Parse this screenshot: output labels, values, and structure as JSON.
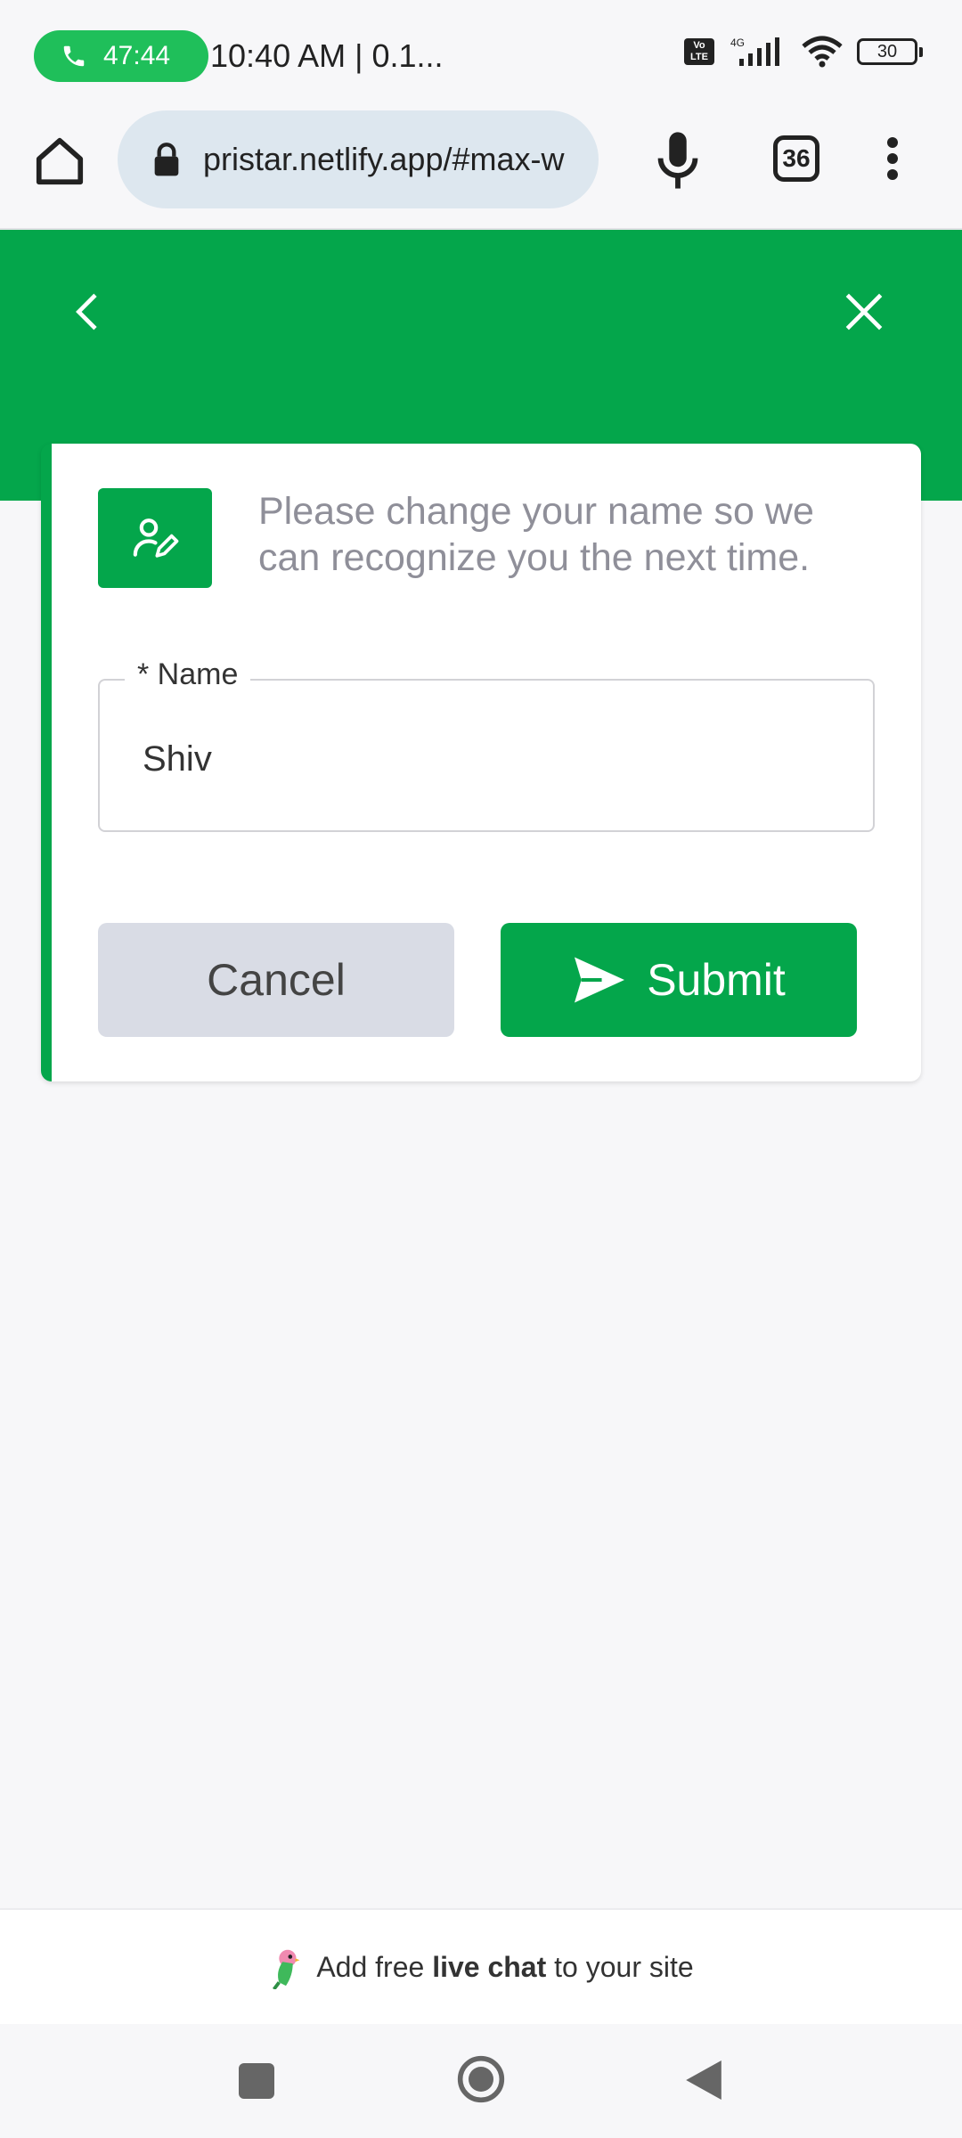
{
  "status_bar": {
    "call_timer": "47:44",
    "clock_text": "10:40 AM | 0.1...",
    "network_label": "4G",
    "volte_label": "Vo LTE",
    "battery_level": "30"
  },
  "browser": {
    "url": "pristar.netlify.app/#max-w",
    "tab_count": "36"
  },
  "form": {
    "prompt": "Please change your name so we can recognize you the next time.",
    "name_label": "* Name",
    "name_value": "Shiv",
    "cancel_label": "Cancel",
    "submit_label": "Submit"
  },
  "footer": {
    "prefix": "Add free",
    "bold": "live chat",
    "suffix": "to your site"
  },
  "colors": {
    "brand_green": "#04a64b",
    "call_green": "#1fbf5a",
    "url_bar_bg": "#dde7ef",
    "cancel_bg": "#d9dce5"
  },
  "icons": [
    "phone-icon",
    "volte-icon",
    "signal-icon",
    "wifi-icon",
    "battery-icon",
    "home-icon",
    "lock-icon",
    "mic-icon",
    "tabs-icon",
    "more-icon",
    "back-icon",
    "close-icon",
    "user-edit-icon",
    "send-icon",
    "parrot-icon",
    "recents-icon",
    "nav-home-icon",
    "nav-back-icon"
  ]
}
